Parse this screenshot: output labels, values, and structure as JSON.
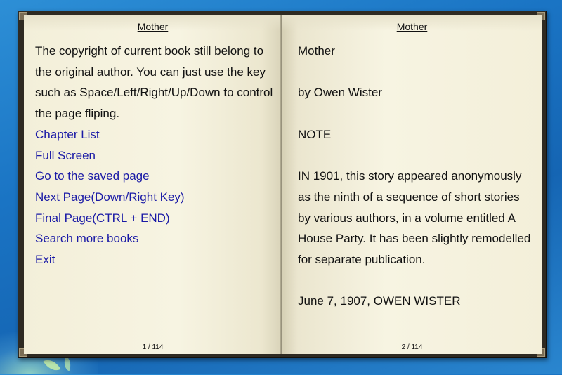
{
  "book": {
    "left_page": {
      "running_title": "Mother",
      "notice": "The copyright of current book still belong to the original author. You can just use the key such as Space/Left/Right/Up/Down to control the page fliping.",
      "links": [
        {
          "label": "Chapter List"
        },
        {
          "label": "Full Screen"
        },
        {
          "label": "Go to the saved page"
        },
        {
          "label": "Next Page(Down/Right Key)"
        },
        {
          "label": "Final Page(CTRL + END)"
        },
        {
          "label": "Search more books"
        },
        {
          "label": "Exit"
        }
      ],
      "page_number": "1 / 114"
    },
    "right_page": {
      "running_title": "Mother",
      "lines": [
        "Mother",
        "",
        "by Owen Wister",
        "",
        "NOTE",
        "",
        "IN 1901, this story appeared anonymously as the ninth of a sequence of short stories by various authors, in a volume entitled A House Party. It has been slightly remodelled for separate publication.",
        "",
        "June 7, 1907, OWEN WISTER"
      ],
      "page_number": "2 / 114"
    }
  },
  "colors": {
    "link": "#1a1aa6",
    "page": "#f6f3df",
    "cover": "#2e2a22",
    "desktop": "#1a74c4"
  }
}
